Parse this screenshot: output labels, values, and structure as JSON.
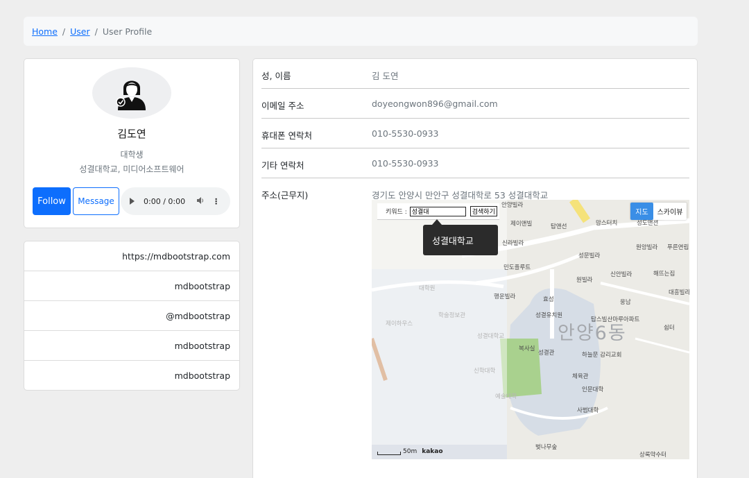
{
  "breadcrumb": {
    "home": "Home",
    "user": "User",
    "current": "User Profile",
    "separator": "/"
  },
  "profile": {
    "name": "김도연",
    "role": "대학생",
    "org": "성결대학교, 미디어소프트웨어",
    "follow_label": "Follow",
    "message_label": "Message",
    "audio_time": "0:00 / 0:00"
  },
  "links": [
    {
      "text": "https://mdbootstrap.com",
      "icon": "globe-icon"
    },
    {
      "text": "mdbootstrap",
      "icon": "github-icon"
    },
    {
      "text": "@mdbootstrap",
      "icon": "twitter-icon"
    },
    {
      "text": "mdbootstrap",
      "icon": "instagram-icon"
    },
    {
      "text": "mdbootstrap",
      "icon": "facebook-icon"
    }
  ],
  "info": {
    "name_label": "성, 이름",
    "name_value": "김 도연",
    "email_label": "이메일 주소",
    "email_value": "doyeongwon896@gmail.com",
    "phone_label": "휴대폰 연락처",
    "phone_value": "010-5530-0933",
    "other_label": "기타 연락처",
    "other_value": "010-5530-0933",
    "address_label": "주소(근무지)",
    "address_value": "경기도 안양시 만안구 성결대학로 53 성결대학교"
  },
  "map": {
    "keyword_label": "키워드 :",
    "keyword_value": "성결대",
    "search_button": "검색하기",
    "tooltip": "성결대학교",
    "map_button": "지도",
    "skyview_button": "스카이뷰",
    "scale": "50m",
    "brand": "kakao",
    "district": "안양6동",
    "pois": [
      "안양빌라",
      "제이앤빌",
      "탑앤선",
      "맘스터치",
      "성도맨션",
      "신라빌라",
      "성문빌라",
      "원앙빌라",
      "푸른연립",
      "민도플루트",
      "원빌라",
      "신안빌라",
      "해뜨는집",
      "행운빌라",
      "효성",
      "대흥빌라",
      "웅남",
      "대학원",
      "학술정보관",
      "제이하우스",
      "성결대학교",
      "성결유치원",
      "탑스빌산마루아파트",
      "쉼터",
      "복사실",
      "성결관",
      "하늘문 감리교회",
      "신학대학",
      "체육관",
      "인문대학",
      "예술대학",
      "사범대학",
      "벚나무숲",
      "상록약수터"
    ]
  }
}
